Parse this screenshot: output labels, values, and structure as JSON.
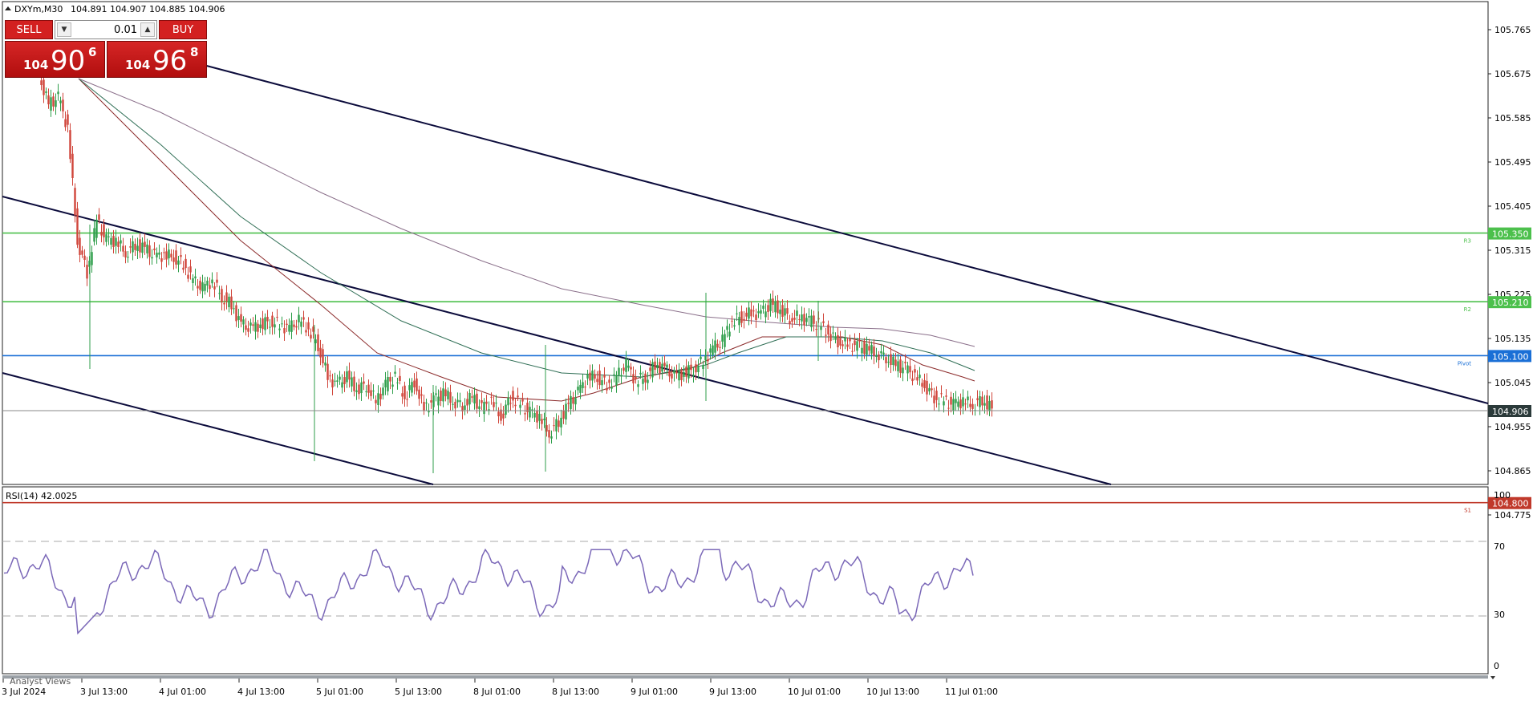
{
  "window": {
    "symbol_label": "DXYm,M30",
    "ohlc_text": "104.891 104.907 104.885 104.906"
  },
  "trade_panel": {
    "sell_label": "SELL",
    "buy_label": "BUY",
    "lot_value": "0.01",
    "bid": {
      "prefix": "104",
      "big": "90",
      "sup": "6"
    },
    "ask": {
      "prefix": "104",
      "big": "96",
      "sup": "8"
    },
    "color": "#d32020"
  },
  "indicator": {
    "label": "RSI(14) 42.0025",
    "axis": [
      "100",
      "70",
      "30",
      "0"
    ],
    "color": "#7b68b8"
  },
  "bottom_panel_label": "Analyst Views",
  "time_labels": [
    "3 Jul 2024",
    "3 Jul 13:00",
    "4 Jul 01:00",
    "4 Jul 13:00",
    "5 Jul 01:00",
    "5 Jul 13:00",
    "8 Jul 01:00",
    "8 Jul 13:00",
    "9 Jul 01:00",
    "9 Jul 13:00",
    "10 Jul 01:00",
    "10 Jul 13:00",
    "11 Jul 01:00"
  ],
  "price_axis": [
    "105.765",
    "105.675",
    "105.585",
    "105.495",
    "105.405",
    "105.315",
    "105.225",
    "105.135",
    "105.045",
    "104.955",
    "104.865",
    "104.775"
  ],
  "levels": [
    {
      "name": "R3",
      "price_label": "105.350",
      "color": "#4cc04c"
    },
    {
      "name": "R2",
      "price_label": "105.210",
      "color": "#4cc04c"
    },
    {
      "name": "Pivot",
      "price_label": "105.100",
      "color": "#1a6fd6"
    },
    {
      "name": "S1",
      "price_label": "104.800",
      "color": "#c0392b"
    }
  ],
  "current_price": {
    "label": "104.906",
    "bg": "#2b3a3a"
  },
  "colors": {
    "bull": "#2e9e4a",
    "bear": "#d0453a",
    "channel": "#0b0b3b",
    "ma_fast": "#8b2a2a",
    "ma_mid": "#2f6e55",
    "ma_slow": "#8a6f8a"
  }
}
